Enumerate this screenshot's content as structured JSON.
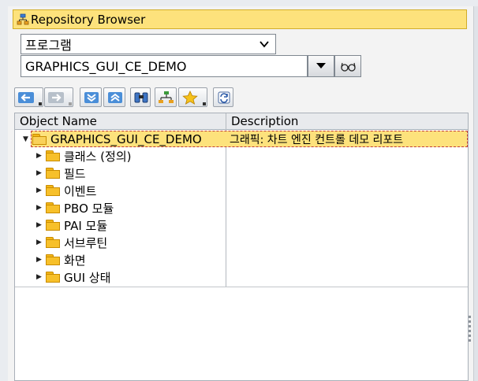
{
  "title": "Repository Browser",
  "object_type": {
    "selected": "프로그램"
  },
  "object_name": {
    "value": "GRAPHICS_GUI_CE_DEMO"
  },
  "toolbar": {
    "buttons": [
      "back-icon",
      "forward-icon",
      "expand-all-icon",
      "collapse-all-icon",
      "find-icon",
      "hierarchy-icon",
      "favorites-icon",
      "refresh-icon"
    ]
  },
  "tree": {
    "columns": [
      "Object Name",
      "Description"
    ],
    "root": {
      "name": "GRAPHICS_GUI_CE_DEMO",
      "description": "그래픽: 차트 엔진 컨트롤 데모 리포트"
    },
    "children": [
      {
        "name": "클래스 (정의)"
      },
      {
        "name": "필드"
      },
      {
        "name": "이벤트"
      },
      {
        "name": "PBO 모듈"
      },
      {
        "name": "PAI 모듈"
      },
      {
        "name": "서브루틴"
      },
      {
        "name": "화면"
      },
      {
        "name": "GUI 상태"
      }
    ]
  },
  "colors": {
    "selection": "#fde27c",
    "folder": "#f7c02a",
    "header": "#e8eaed"
  }
}
